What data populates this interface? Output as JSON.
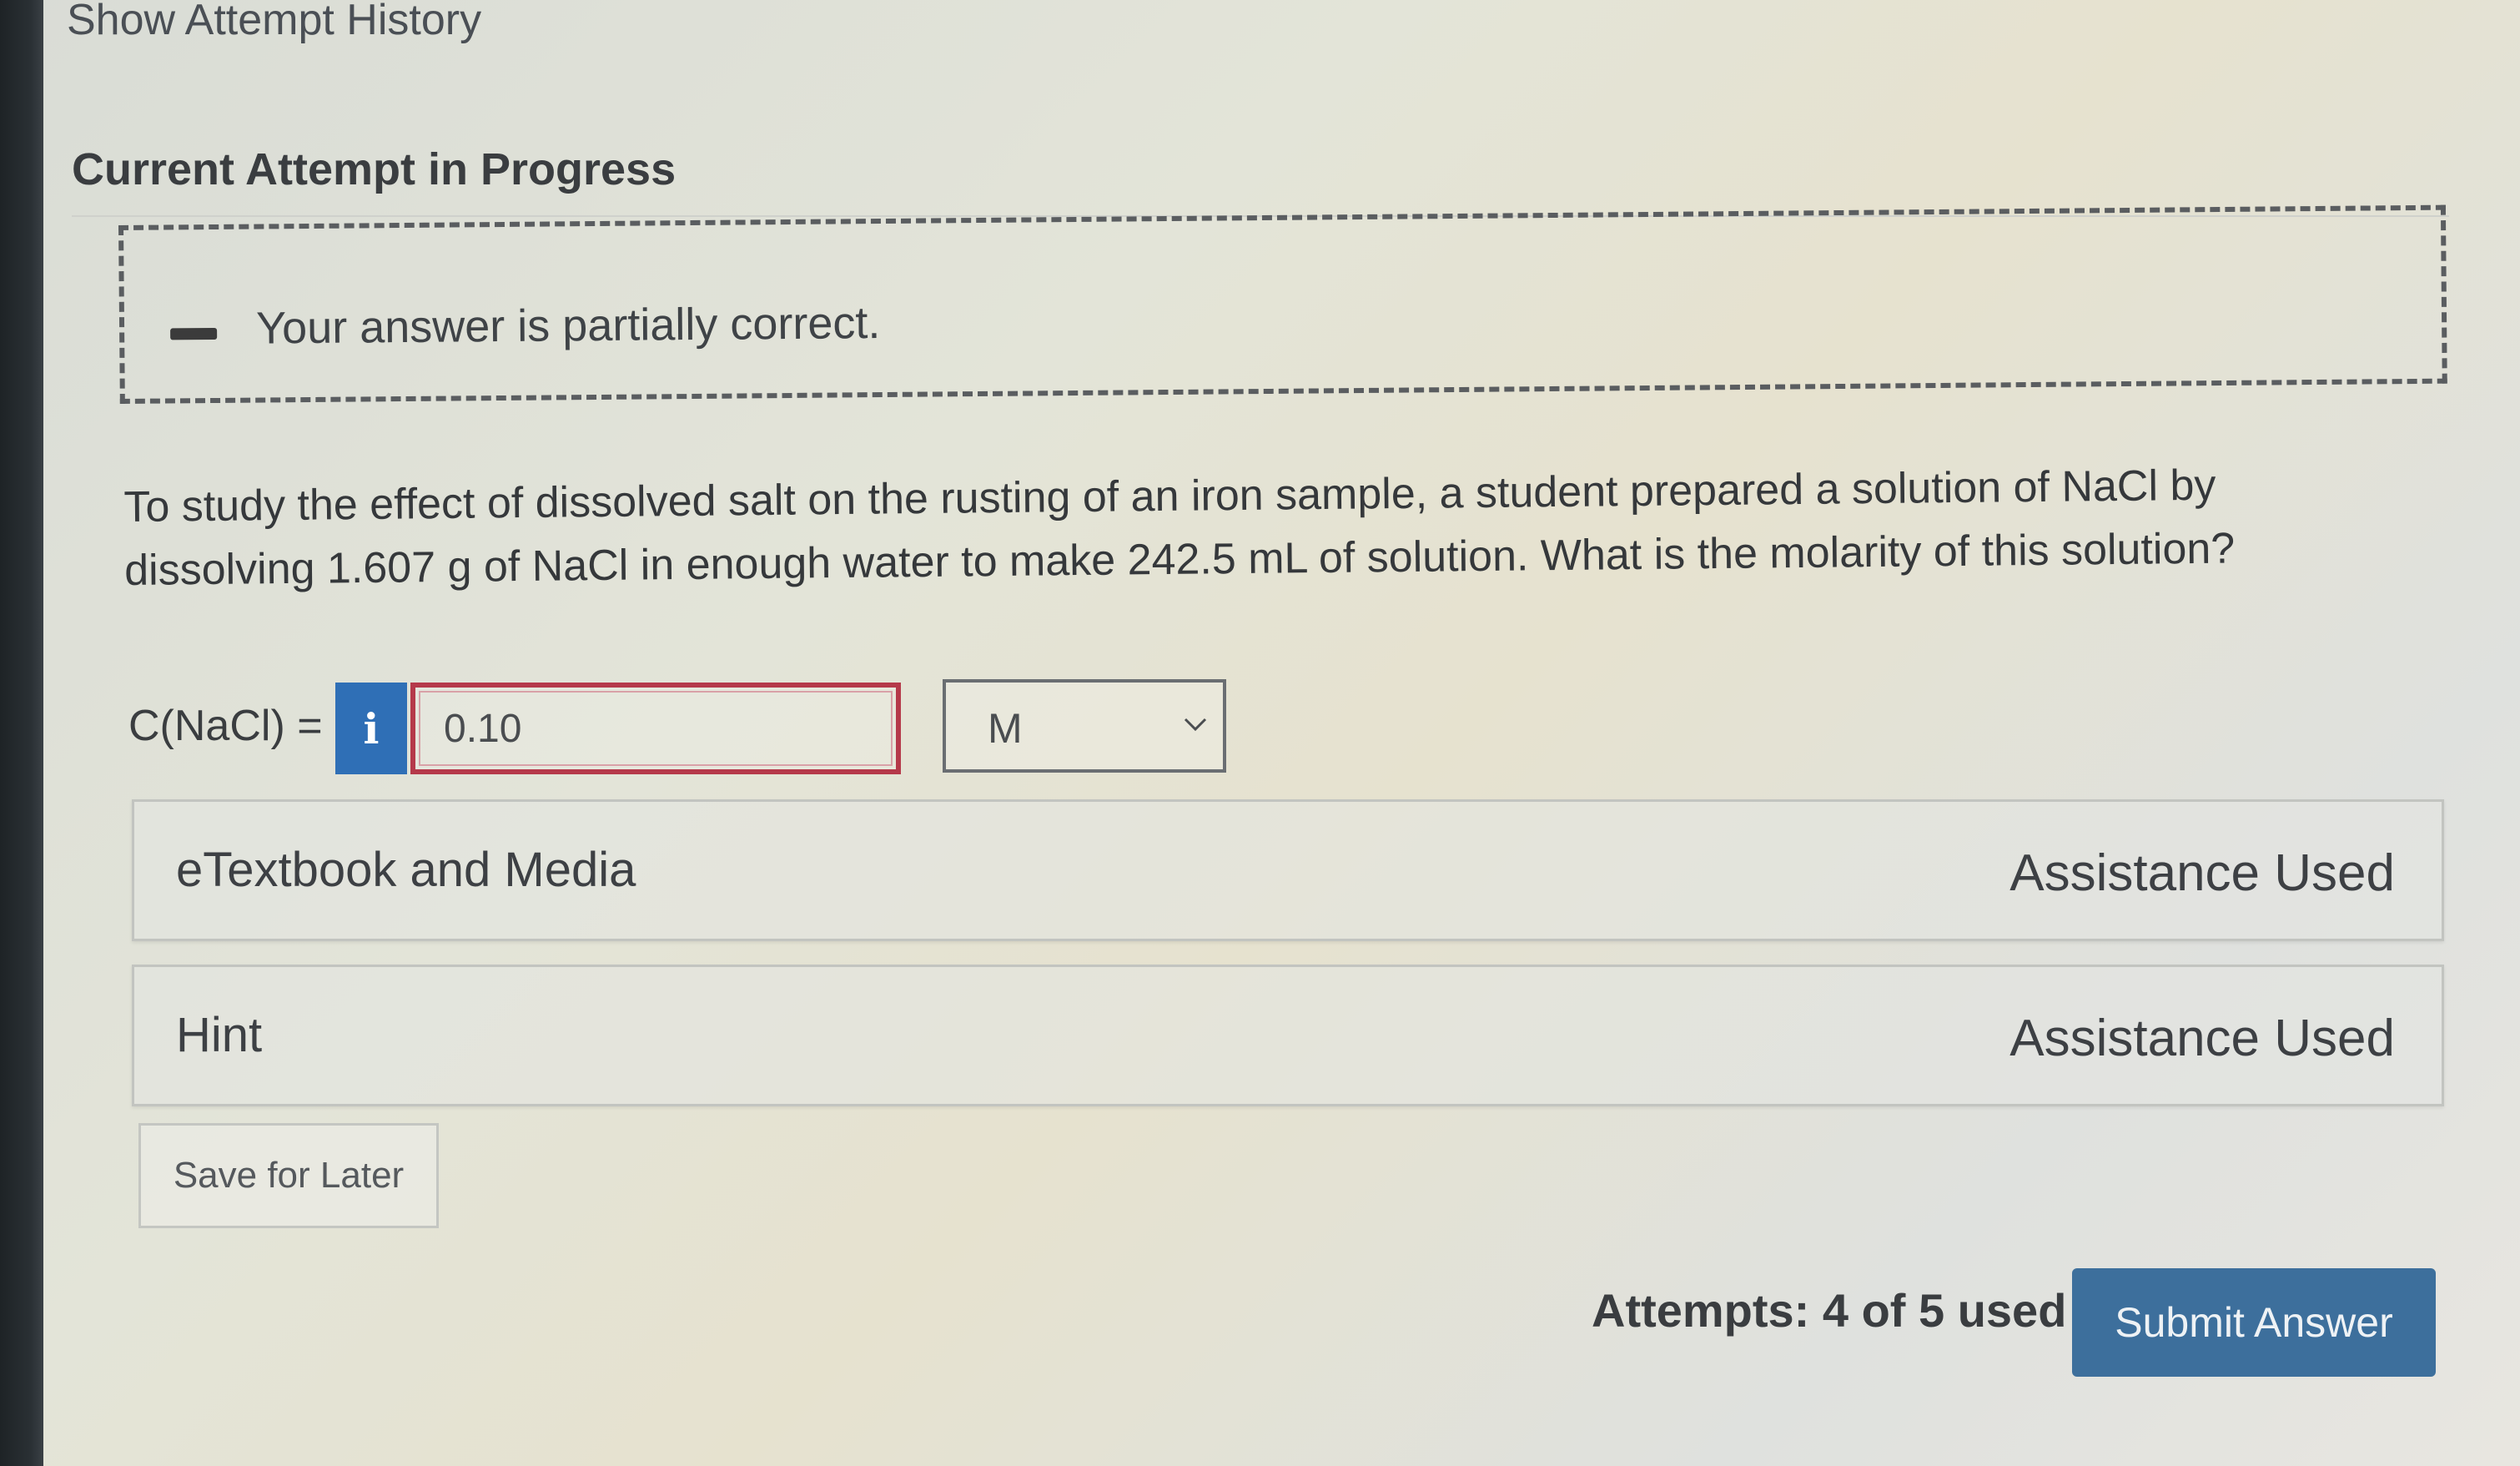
{
  "header": {
    "show_history_link": "Show Attempt History",
    "section_title": "Current Attempt in Progress"
  },
  "feedback": {
    "icon": "partial-correct-icon",
    "text": "Your answer is partially correct."
  },
  "question": {
    "text": "To study the effect of dissolved salt on the rusting of an iron sample, a student prepared a solution of NaCl by dissolving 1.607 g of NaCl in enough water to make 242.5 mL of solution. What is the molarity of this solution?"
  },
  "answer": {
    "label": "C(NaCl) =",
    "info_glyph": "i",
    "value": "0.10",
    "unit_selected": "M"
  },
  "panels": [
    {
      "title": "eTextbook and Media",
      "status": "Assistance Used"
    },
    {
      "title": "Hint",
      "status": "Assistance Used"
    }
  ],
  "footer": {
    "save_label": "Save for Later",
    "attempts_text": "Attempts: 4 of 5 used",
    "submit_label": "Submit Answer"
  },
  "colors": {
    "info_button": "#2f6fb6",
    "submit_button": "#3d6f9c",
    "incorrect_border": "#b5394a"
  }
}
